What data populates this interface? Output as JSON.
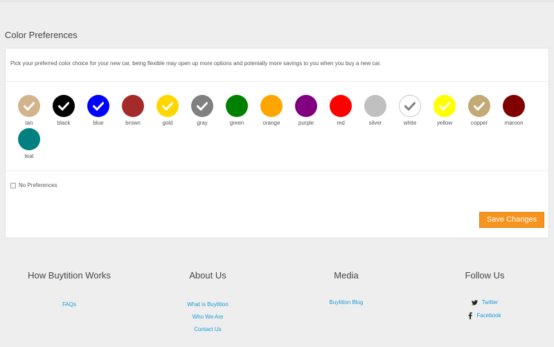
{
  "section": {
    "title": "Color Preferences"
  },
  "intro": "Pick your preferred color choice for your new car, being flexible may open up more options and potenially more savings to you when you buy a new car.",
  "colors": [
    {
      "name": "tan",
      "hex": "#d2b48c",
      "checked": true,
      "check_color": "#ffffff"
    },
    {
      "name": "black",
      "hex": "#000000",
      "checked": true,
      "check_color": "#ffffff"
    },
    {
      "name": "blue",
      "hex": "#0000ff",
      "checked": true,
      "check_color": "#ffffff"
    },
    {
      "name": "brown",
      "hex": "#a52a2a",
      "checked": false,
      "check_color": "#ffffff"
    },
    {
      "name": "gold",
      "hex": "#ffd700",
      "checked": true,
      "check_color": "#ffffff"
    },
    {
      "name": "gray",
      "hex": "#808080",
      "checked": true,
      "check_color": "#ffffff"
    },
    {
      "name": "green",
      "hex": "#008000",
      "checked": false,
      "check_color": "#ffffff"
    },
    {
      "name": "orange",
      "hex": "#ffa500",
      "checked": false,
      "check_color": "#ffffff"
    },
    {
      "name": "purple",
      "hex": "#800080",
      "checked": false,
      "check_color": "#ffffff"
    },
    {
      "name": "red",
      "hex": "#ff0000",
      "checked": false,
      "check_color": "#ffffff"
    },
    {
      "name": "silver",
      "hex": "#c0c0c0",
      "checked": false,
      "check_color": "#ffffff"
    },
    {
      "name": "white",
      "hex": "#ffffff",
      "checked": true,
      "check_color": "#808080"
    },
    {
      "name": "yellow",
      "hex": "#ffff00",
      "checked": true,
      "check_color": "#ffffff"
    },
    {
      "name": "copper",
      "hex": "#c2aa76",
      "checked": true,
      "check_color": "#ffffff"
    },
    {
      "name": "maroon",
      "hex": "#800000",
      "checked": false,
      "check_color": "#ffffff"
    },
    {
      "name": "teal",
      "hex": "#008080",
      "checked": false,
      "check_color": "#ffffff"
    }
  ],
  "no_preferences": {
    "label": "No Preferences",
    "checked": false
  },
  "save_button": {
    "label": "Save Changes",
    "color": "#f7941d"
  },
  "footer": {
    "how": {
      "title": "How Buytition Works",
      "links": [
        "FAQs"
      ]
    },
    "about": {
      "title": "About Us",
      "links": [
        "What is Buytition",
        "Who We Are",
        "Contact Us"
      ]
    },
    "media": {
      "title": "Media",
      "links": [
        "Buytition Blog"
      ]
    },
    "follow": {
      "title": "Follow Us",
      "links": [
        {
          "label": "Twitter",
          "icon": "twitter-icon"
        },
        {
          "label": "Facebook",
          "icon": "facebook-icon"
        }
      ]
    }
  },
  "accent": "#1a9cd8"
}
